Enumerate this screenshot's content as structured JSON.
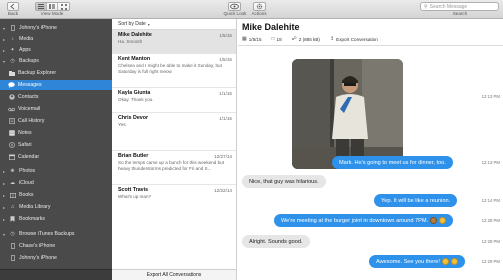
{
  "toolbar": {
    "back_label": "Back",
    "view_mode_label": "View Mode",
    "quick_look_label": "Quick Look",
    "actions_label": "Actions",
    "search_placeholder": "Search Message",
    "search_label": "Search",
    "icons": {
      "back": "chevron-left-icon",
      "view_mode": [
        "list-view-icon",
        "column-view-icon",
        "grid-view-icon"
      ],
      "quick_look": "eye-icon",
      "actions": "gear-icon",
      "search": "magnifier-icon"
    }
  },
  "sidebar": {
    "items": [
      {
        "label": "Johnny's iPhone",
        "icon": "phone-icon",
        "level": 0,
        "arrow": "down"
      },
      {
        "label": "Media",
        "icon": "music-note-icon",
        "level": 0,
        "arrow": "right"
      },
      {
        "label": "Apps",
        "icon": "apps-icon",
        "level": 0,
        "arrow": "right"
      },
      {
        "label": "Backups",
        "icon": "clock-icon",
        "level": 0,
        "arrow": "down"
      },
      {
        "label": "Backup Explorer",
        "icon": "folder-icon",
        "level": 1
      },
      {
        "label": "Messages",
        "icon": "speech-bubble-icon",
        "level": 1,
        "selected": true
      },
      {
        "label": "Contacts",
        "icon": "contacts-icon",
        "level": 1
      },
      {
        "label": "Voicemail",
        "icon": "voicemail-icon",
        "level": 1
      },
      {
        "label": "Call History",
        "icon": "call-history-icon",
        "level": 1
      },
      {
        "label": "Notes",
        "icon": "notes-icon",
        "level": 1
      },
      {
        "label": "Safari",
        "icon": "compass-icon",
        "level": 1
      },
      {
        "label": "Calendar",
        "icon": "calendar-icon",
        "level": 1
      },
      {
        "label": "Photos",
        "icon": "photos-icon",
        "level": 0,
        "arrow": "right"
      },
      {
        "label": "iCloud",
        "icon": "cloud-icon",
        "level": 0,
        "arrow": "right"
      },
      {
        "label": "Books",
        "icon": "book-icon",
        "level": 0,
        "arrow": "right"
      },
      {
        "label": "Media Library",
        "icon": "media-library-icon",
        "level": 0,
        "arrow": "right"
      },
      {
        "label": "Bookmarks",
        "icon": "bookmark-icon",
        "level": 0,
        "arrow": "right"
      },
      {
        "label": "Browse iTunes Backups",
        "icon": "clock-icon",
        "level": 0,
        "arrow": "down"
      },
      {
        "label": "Chase's iPhone",
        "icon": "phone-icon",
        "level": 0
      },
      {
        "label": "Johnny's iPhone",
        "icon": "phone-icon",
        "level": 0
      }
    ]
  },
  "conversations": {
    "sort_label": "Sort by Date",
    "items": [
      {
        "name": "Mike Dalehite",
        "date": "1/5/15",
        "preview": "Ha. Smooth",
        "selected": true
      },
      {
        "name": "Kent Manton",
        "date": "1/5/15",
        "preview": "Chelsea and I might be able to make it Sunday, but Saturday is full right meow"
      },
      {
        "name": "Kayla Giunta",
        "date": "1/1/15",
        "preview": "Okay. Thank you."
      },
      {
        "name": "Chris Devor",
        "date": "1/1/15",
        "preview": "Yes."
      },
      {
        "name": "Brian Butler",
        "date": "12/27/14",
        "preview": "So the temps came up a bunch for this weekend but heavy thunderstorms predicted for Fri and S..."
      },
      {
        "name": "Scott Travis",
        "date": "12/22/14",
        "preview": "What's up man?"
      }
    ],
    "export_all_label": "Export All Conversations"
  },
  "thread": {
    "title": "Mike Dalehite",
    "info": {
      "date": "1/5/15",
      "count": "18",
      "size": "2 (885 kB)",
      "export_label": "Export Conversation"
    },
    "messages": [
      {
        "type": "photo",
        "direction": "in",
        "time": "12:13 PM"
      },
      {
        "type": "text",
        "direction": "out",
        "text": "Mark. He's going to meet us for dinner, too.",
        "time": "12:13 PM"
      },
      {
        "type": "text",
        "direction": "in",
        "text": "Nice, that guy was hilarious.",
        "time": ""
      },
      {
        "type": "text",
        "direction": "out",
        "text": "Yep. It will be like a reunion.",
        "time": "12:14 PM"
      },
      {
        "type": "text",
        "direction": "out",
        "text": "We're meeting at the burger joint in downtown around 7PM.",
        "time": "12:28 PM",
        "emoji": [
          "burger-emoji",
          "grin-emoji"
        ]
      },
      {
        "type": "text",
        "direction": "in",
        "text": "Alright. Sounds good.",
        "time": "12:28 PM"
      },
      {
        "type": "text",
        "direction": "out",
        "text": "Awesome. See you there!",
        "time": "12:29 PM",
        "emoji": [
          "grin-emoji",
          "smile-emoji"
        ]
      }
    ]
  },
  "colors": {
    "sidebar_bg": "#4a4a4a",
    "selection": "#2f86d8",
    "bubble_out": "#2f92ea",
    "bubble_in": "#e6e6e6"
  }
}
